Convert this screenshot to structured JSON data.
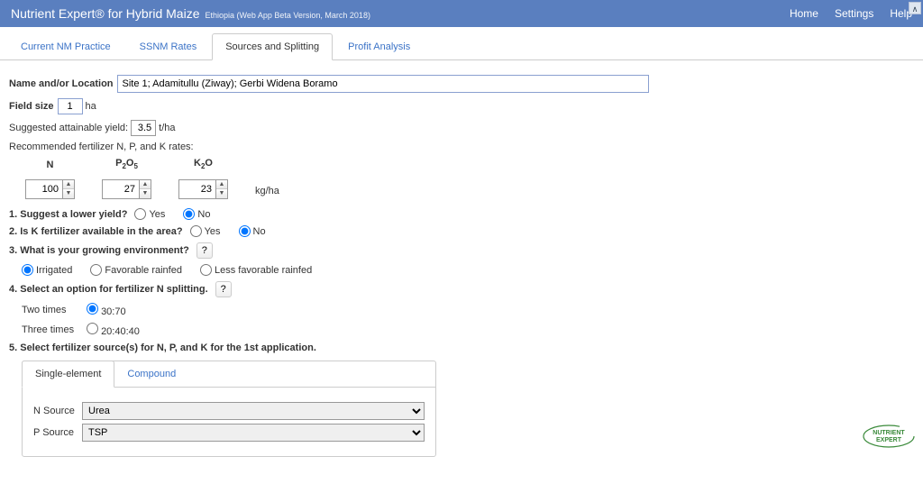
{
  "topbar": {
    "title": "Nutrient Expert® for Hybrid Maize",
    "sub": "Ethiopia (Web App Beta Version, March 2018)",
    "nav": {
      "home": "Home",
      "settings": "Settings",
      "help": "Help"
    }
  },
  "tabs": {
    "current": "Current NM Practice",
    "ssnm": "SSNM Rates",
    "sources": "Sources and Splitting",
    "profit": "Profit Analysis"
  },
  "form": {
    "loc_label": "Name and/or Location",
    "loc_value": "Site 1; Adamitullu (Ziway); Gerbi Widena Boramo",
    "fieldsize_label": "Field size",
    "fieldsize_value": "1",
    "fieldsize_unit": "ha",
    "yield_label": "Suggested attainable yield:",
    "yield_value": "3.5",
    "yield_unit": "t/ha",
    "rates_label": "Recommended fertilizer N, P, and K rates:",
    "n_label": "N",
    "p_label_html": "P₂O₅",
    "k_label_html": "K₂O",
    "n_val": "100",
    "p_val": "27",
    "k_val": "23",
    "rates_unit": "kg/ha",
    "q1": "1. Suggest a lower yield?",
    "q2": "2. Is K fertilizer available in the area?",
    "q3": "3. What is your growing environment?",
    "q4": "4. Select an option for fertilizer N splitting.",
    "q5": "5. Select fertilizer source(s) for N, P, and K for the 1st application.",
    "yes": "Yes",
    "no": "No",
    "env_irrigated": "Irrigated",
    "env_fav": "Favorable rainfed",
    "env_less": "Less favorable rainfed",
    "help": "?",
    "two_times": "Two times",
    "three_times": "Three times",
    "split_2": "30:70",
    "split_3": "20:40:40",
    "inner_single": "Single-element",
    "inner_compound": "Compound",
    "n_source_label": "N Source",
    "p_source_label": "P Source",
    "n_source_value": "Urea",
    "p_source_value": "TSP"
  },
  "logo_line1": "NUTRIENT",
  "logo_line2": "EXPERT"
}
